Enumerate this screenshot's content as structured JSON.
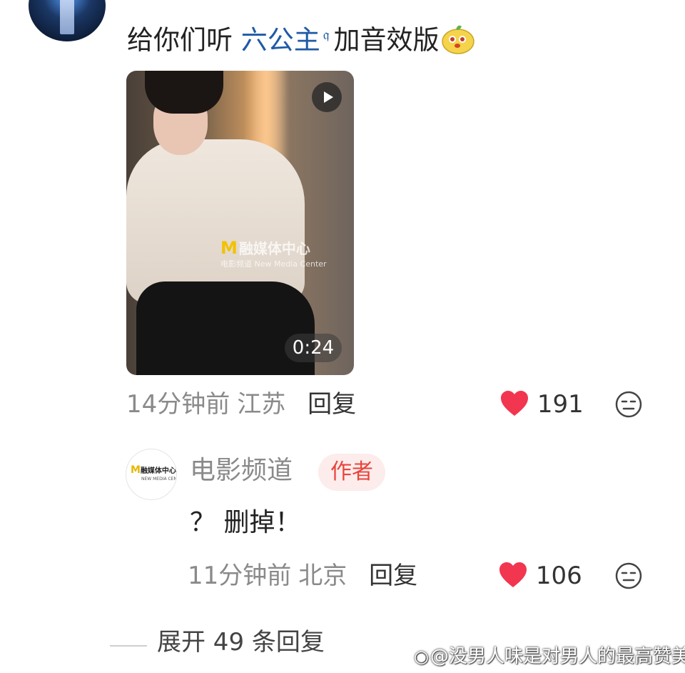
{
  "comment": {
    "text_prefix": "给你们听",
    "mention": "六公主",
    "mention_icon": "search-icon",
    "text_suffix": "加音效版",
    "emoji": "yellow-creature-emoji"
  },
  "video": {
    "watermark_title": "融媒体中心",
    "watermark_sub": "New Media Center",
    "watermark_small": "电影频道",
    "duration": "0:24",
    "play_icon": "play-icon"
  },
  "comment_meta": {
    "time": "14分钟前",
    "location": "江苏",
    "reply_label": "回复",
    "like_count": "191"
  },
  "sub_comment": {
    "avatar_text": "融媒体中心",
    "avatar_sub": "NEW MEDIA CENTER",
    "author_name": "电影频道",
    "author_badge": "作者",
    "text": "？ 删掉！",
    "time": "11分钟前",
    "location": "北京",
    "reply_label": "回复",
    "like_count": "106"
  },
  "expand": {
    "label": "展开 49 条回复"
  },
  "watermark": {
    "text": "@没男人味是对男人的最高赞美"
  },
  "colors": {
    "heart": "#f2364f",
    "mention": "#1f5aa5",
    "badge_text": "#e8453c",
    "badge_bg": "#fdecec",
    "meta_gray": "#8a8a8a"
  }
}
